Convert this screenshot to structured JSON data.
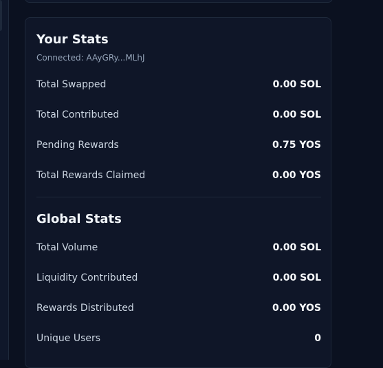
{
  "your_stats": {
    "title": "Your Stats",
    "connected": "Connected: AAyGRy...MLhJ",
    "rows": [
      {
        "label": "Total Swapped",
        "value": "0.00 SOL"
      },
      {
        "label": "Total Contributed",
        "value": "0.00 SOL"
      },
      {
        "label": "Pending Rewards",
        "value": "0.75 YOS"
      },
      {
        "label": "Total Rewards Claimed",
        "value": "0.00 YOS"
      }
    ]
  },
  "global_stats": {
    "title": "Global Stats",
    "rows": [
      {
        "label": "Total Volume",
        "value": "0.00 SOL"
      },
      {
        "label": "Liquidity Contributed",
        "value": "0.00 SOL"
      },
      {
        "label": "Rewards Distributed",
        "value": "0.00 YOS"
      },
      {
        "label": "Unique Users",
        "value": "0"
      }
    ]
  }
}
